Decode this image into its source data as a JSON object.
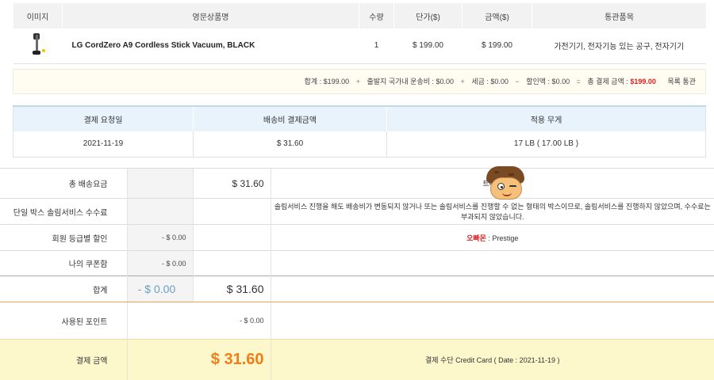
{
  "product_table": {
    "headers": [
      "이미지",
      "영문상품명",
      "수량",
      "단가($)",
      "금액($)",
      "통관품목"
    ],
    "row": {
      "image_icon": "vacuum-product-image",
      "name": "LG CordZero A9 Cordless Stick Vacuum, BLACK",
      "quantity": "1",
      "unit_price": "$ 199.00",
      "amount": "$ 199.00",
      "category": "가전기기, 전자기능 있는 공구, 전자기기"
    }
  },
  "summary": {
    "total": "합계 : $199.00",
    "plus": "+",
    "shipping": "출발지 국가내 운송비 : $0.00",
    "tax": "세금 : $0.00",
    "minus": "−",
    "discount": "할인액 : $0.00",
    "equals": "=",
    "grand_label": "총 결제 금액 :",
    "grand_value": "$199.00",
    "customs": "목록 통관"
  },
  "shipping_info": {
    "headers": [
      "결제 요청일",
      "배송비 결제금액",
      "적용 무게"
    ],
    "values": [
      "2021-11-19",
      "$ 31.60",
      "17 LB ( 17.00 LB )"
    ]
  },
  "fees": {
    "total_shipping": {
      "label": "총 배송요금",
      "amount": "$ 31.60",
      "note": "트래킹"
    },
    "single_box": {
      "label": "단일 박스 솔림서비스 수수료",
      "note": "솔림서비스 진행을 해도 배송비가 변동되지 않거나 또는 솔림서비스를 진행할 수 없는 형태의 박스이므로, 솔림서비스를 진행하지 않았으며, 수수료는 부과되지 않았습니다."
    },
    "member_discount": {
      "label": "회원 등급별 할인",
      "amount": "- $ 0.00",
      "grade_label": "오빠몬",
      "grade_value": " : Prestige"
    },
    "coupon": {
      "label": "나의 쿠폰함",
      "amount": "- $ 0.00"
    },
    "subtotal": {
      "label": "합계",
      "discount": "- $ 0.00",
      "amount": "$ 31.60"
    },
    "points": {
      "label": "사용된 포인트",
      "amount": "- $ 0.00"
    },
    "payment": {
      "label": "결제 금액",
      "amount": "$ 31.60",
      "method": "결제 수단 Credit Card ( Date : 2021-11-19 )"
    }
  },
  "colors": {
    "accent_red": "#e02020",
    "pay_orange": "#f07c1a",
    "discount_blue": "#6a9fc0",
    "pay_row_bg": "#fdf7cc",
    "ship_header_bg": "#e8f3fb"
  },
  "mascot_icon": "winking-chestnut-mascot-icon"
}
